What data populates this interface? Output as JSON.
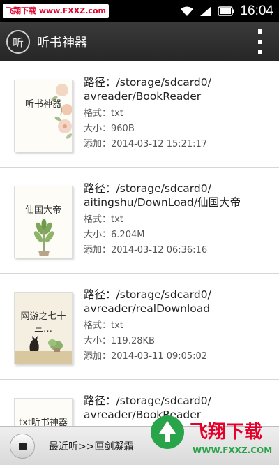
{
  "status_bar": {
    "watermark": "飞翔下载 www.FXXZ.com",
    "time": "16:04",
    "battery_label": "94"
  },
  "app_bar": {
    "logo_char": "听",
    "title": "听书神器"
  },
  "labels": {
    "path": "路径：",
    "format": "格式：",
    "size": "大小：",
    "added": "添加："
  },
  "books": [
    {
      "cover_title": "听书神器",
      "path_line1": "/storage/sdcard0/",
      "path_line2": "avreader/BookReader",
      "format": "txt",
      "size": "960B",
      "added": "2014-03-12 15:21:17"
    },
    {
      "cover_title": "仙国大帝",
      "path_line1": "/storage/sdcard0/",
      "path_line2": "aitingshu/DownLoad/仙国大帝",
      "format": "txt",
      "size": "6.204M",
      "added": "2014-03-12 06:36:16"
    },
    {
      "cover_title": "网游之七十三…",
      "path_line1": "/storage/sdcard0/",
      "path_line2": "avreader/realDownload",
      "format": "txt",
      "size": "119.28KB",
      "added": "2014-03-11 09:05:02"
    },
    {
      "cover_title": "txt听书神器",
      "path_line1": "/storage/sdcard0/",
      "path_line2": "avreader/BookReader",
      "format": "",
      "size": "",
      "added": ""
    }
  ],
  "player": {
    "recent": "最近听>>匣剑凝霜"
  },
  "watermark_bottom": {
    "brand": "飞翔下载",
    "url": "WWW.FXXZ.COM"
  },
  "colors": {
    "watermark_red": "#e4002b",
    "watermark_green": "#2aa44a"
  }
}
